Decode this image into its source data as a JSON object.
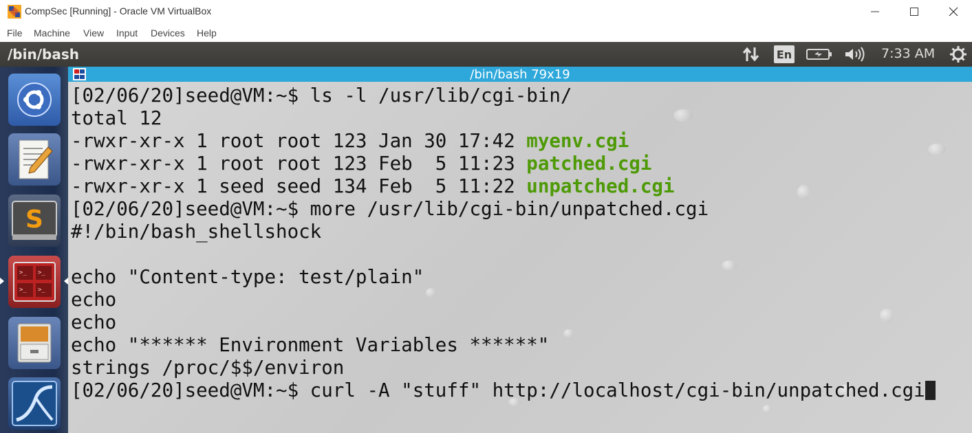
{
  "window": {
    "title": "CompSec [Running] - Oracle VM VirtualBox",
    "controls": [
      "minimize-icon",
      "maximize-icon",
      "close-icon"
    ]
  },
  "menubar": {
    "items": [
      "File",
      "Machine",
      "View",
      "Input",
      "Devices",
      "Help"
    ]
  },
  "panel": {
    "title": "/bin/bash",
    "language": "En",
    "clock": "7:33 AM",
    "indicators": [
      "network-arrows-icon",
      "language-indicator",
      "battery-icon",
      "volume-icon",
      "settings-gear-icon"
    ]
  },
  "launcher": {
    "items": [
      "ubuntu-dash-icon",
      "text-editor-icon",
      "sublime-text-icon",
      "terminal-icon",
      "file-manager-icon",
      "wireshark-icon"
    ]
  },
  "terminal": {
    "title": "/bin/bash 79x19",
    "lines": [
      {
        "text": "[02/06/20]seed@VM:~$ ls -l /usr/lib/cgi-bin/",
        "suffix": ""
      },
      {
        "text": "total 12",
        "suffix": ""
      },
      {
        "text": "-rwxr-xr-x 1 root root 123 Jan 30 17:42 ",
        "suffix": "myenv.cgi"
      },
      {
        "text": "-rwxr-xr-x 1 root root 123 Feb  5 11:23 ",
        "suffix": "patched.cgi"
      },
      {
        "text": "-rwxr-xr-x 1 seed seed 134 Feb  5 11:22 ",
        "suffix": "unpatched.cgi"
      },
      {
        "text": "[02/06/20]seed@VM:~$ more /usr/lib/cgi-bin/unpatched.cgi",
        "suffix": ""
      },
      {
        "text": "#!/bin/bash_shellshock",
        "suffix": ""
      },
      {
        "text": "",
        "suffix": ""
      },
      {
        "text": "echo \"Content-type: test/plain\"",
        "suffix": ""
      },
      {
        "text": "echo",
        "suffix": ""
      },
      {
        "text": "echo",
        "suffix": ""
      },
      {
        "text": "echo \"****** Environment Variables ******\"",
        "suffix": ""
      },
      {
        "text": "strings /proc/$$/environ",
        "suffix": ""
      },
      {
        "text": "[02/06/20]seed@VM:~$ curl -A \"stuff\" http://localhost/cgi-bin/unpatched.cgi",
        "suffix": ""
      }
    ],
    "colors": {
      "executable": "#4e9a06",
      "titlebar": "#2ea8db",
      "text": "#111111"
    }
  }
}
